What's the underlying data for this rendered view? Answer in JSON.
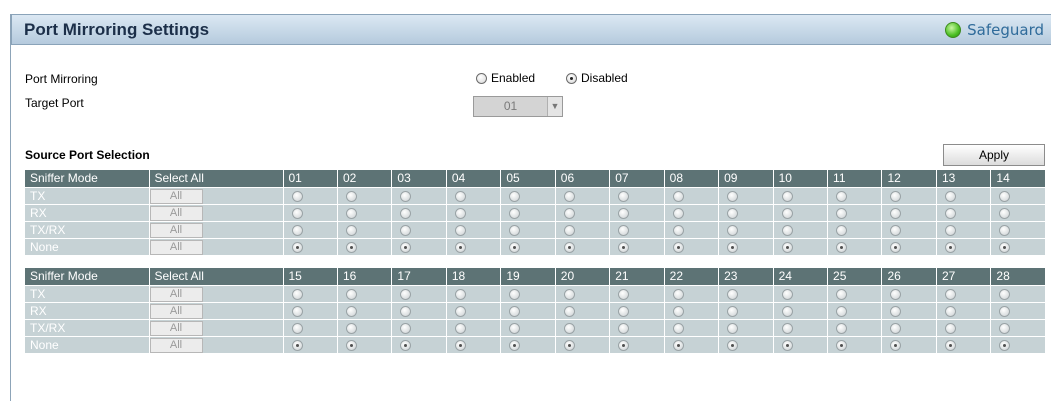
{
  "header": {
    "title": "Port Mirroring Settings",
    "status_label": "Safeguard"
  },
  "form": {
    "port_mirroring_label": "Port Mirroring",
    "enabled_label": "Enabled",
    "disabled_label": "Disabled",
    "mirroring_value": "Disabled",
    "target_port_label": "Target Port",
    "target_port_value": "01"
  },
  "source": {
    "title": "Source Port Selection",
    "apply_label": "Apply",
    "mode_header": "Sniffer Mode",
    "select_all_header": "Select All",
    "all_label": "All",
    "modes": [
      "TX",
      "RX",
      "TX/RX",
      "None"
    ],
    "selected_mode": "None",
    "port_groups": [
      [
        "01",
        "02",
        "03",
        "04",
        "05",
        "06",
        "07",
        "08",
        "09",
        "10",
        "11",
        "12",
        "13",
        "14"
      ],
      [
        "15",
        "16",
        "17",
        "18",
        "19",
        "20",
        "21",
        "22",
        "23",
        "24",
        "25",
        "26",
        "27",
        "28"
      ]
    ]
  },
  "colors": {
    "header_bg": "#5d7375",
    "row_bg": "#c6d2d5",
    "title_bar": "#b5cadd",
    "status_green": "#4bbf24"
  }
}
